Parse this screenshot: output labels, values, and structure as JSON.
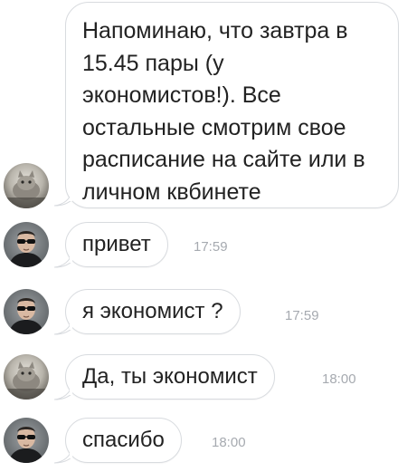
{
  "messages": [
    {
      "sender": "friend",
      "text": "Напоминаю, что завтра в 15.45 пары (у экономистов!). Все остальные смотрим свое расписание на сайте или в личном квбинете",
      "time": ""
    },
    {
      "sender": "user",
      "text": "привет",
      "time": "17:59"
    },
    {
      "sender": "user",
      "text": "я экономист ?",
      "time": "17:59"
    },
    {
      "sender": "friend",
      "text": "Да, ты экономист",
      "time": "18:00"
    },
    {
      "sender": "user",
      "text": "спасибо",
      "time": "18:00"
    }
  ],
  "avatars": {
    "friend": "cat-photo-avatar",
    "user": "man-sunglasses-avatar"
  },
  "colors": {
    "bubble_border": "#d8dbdf",
    "text": "#222222",
    "timestamp": "#a6aab0",
    "background": "#ffffff"
  }
}
